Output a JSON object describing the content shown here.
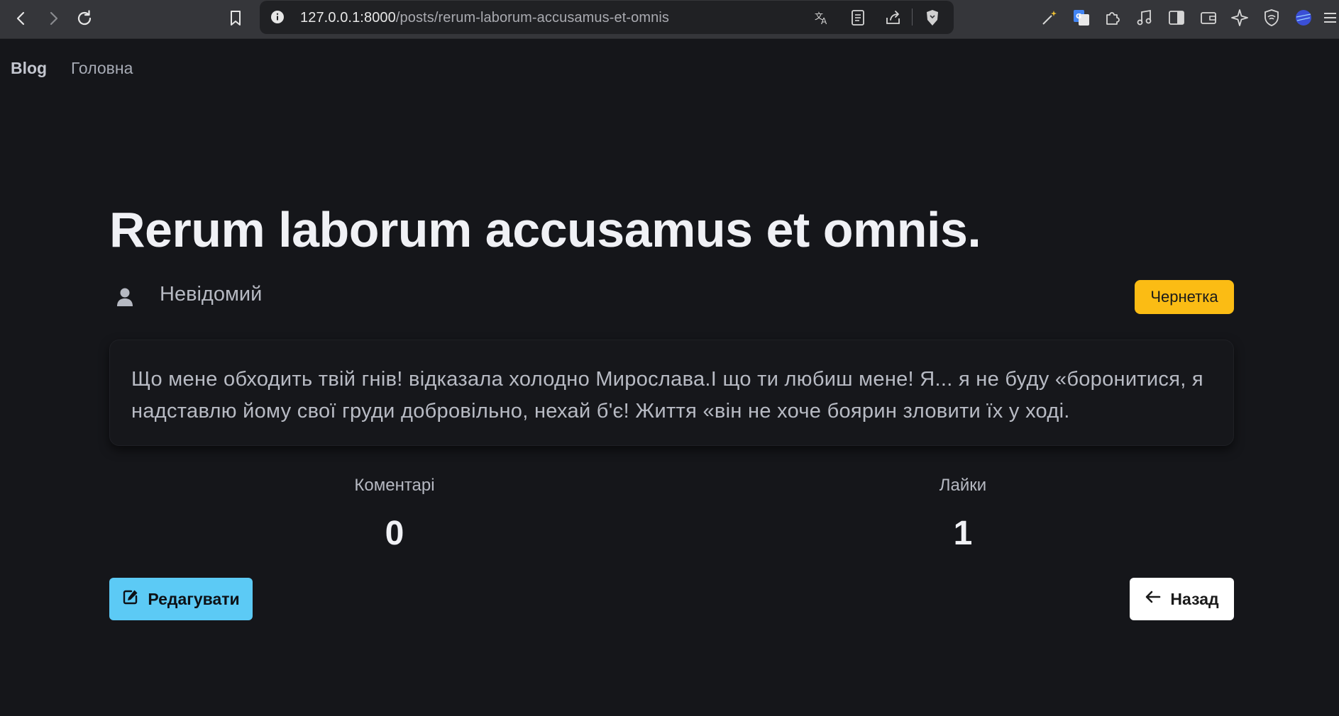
{
  "browser": {
    "url_host": "127.0.0.1:8000",
    "url_path": "/posts/rerum-laborum-accusamus-et-omnis",
    "icons": [
      "back-icon",
      "forward-icon",
      "reload-icon",
      "bookmark-icon",
      "site-info-icon",
      "translate-icon",
      "reader-mode-icon",
      "share-icon",
      "brave-shields-icon",
      "magic-wand-icon",
      "google-translate-icon",
      "extensions-icon",
      "media-icon",
      "sidebar-icon",
      "wallet-icon",
      "leo-ai-icon",
      "vpn-icon",
      "profile-icon",
      "menu-icon"
    ]
  },
  "navbar": {
    "brand": "Blog",
    "links": [
      "Головна"
    ]
  },
  "post": {
    "title": "Rerum laborum accusamus et omnis.",
    "author": "Невідомий",
    "status": "Чернетка",
    "body": "Що мене обходить твій гнів! відказала холодно Мирослава.І що ти любиш мене! Я... я не буду «боронитися, я надставлю йому свої груди добровільно, нехай б'є! Життя «він не хоче боярин зловити їх у ході."
  },
  "stats": {
    "comments_label": "Коментарі",
    "comments_value": "0",
    "likes_label": "Лайки",
    "likes_value": "1"
  },
  "actions": {
    "edit_label": "Редагувати",
    "back_label": "Назад"
  },
  "colors": {
    "page_bg": "#15161a",
    "badge_bg": "#fbbc14",
    "edit_bg": "#5ccaf5",
    "back_bg": "#ffffff"
  }
}
